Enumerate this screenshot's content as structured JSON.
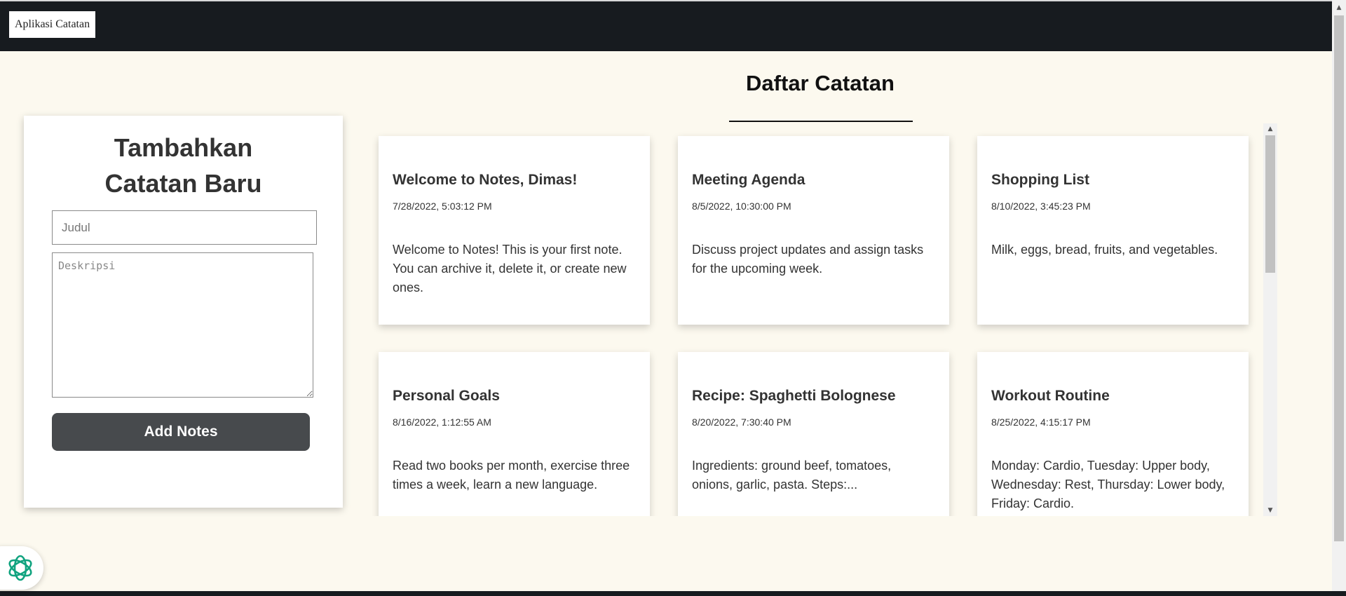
{
  "header": {
    "brand": "Aplikasi Catatan"
  },
  "add_form": {
    "title_line1": "Tambahkan",
    "title_line2": "Catatan Baru",
    "title_placeholder": "Judul",
    "title_value": "",
    "description_placeholder": "Deskripsi",
    "description_value": "",
    "submit_label": "Add Notes"
  },
  "list": {
    "heading": "Daftar Catatan",
    "notes": [
      {
        "title": "Welcome to Notes, Dimas!",
        "date": "7/28/2022, 5:03:12 PM",
        "body": "Welcome to Notes! This is your first note. You can archive it, delete it, or create new ones."
      },
      {
        "title": "Meeting Agenda",
        "date": "8/5/2022, 10:30:00 PM",
        "body": "Discuss project updates and assign tasks for the upcoming week."
      },
      {
        "title": "Shopping List",
        "date": "8/10/2022, 3:45:23 PM",
        "body": "Milk, eggs, bread, fruits, and vegetables."
      },
      {
        "title": "Personal Goals",
        "date": "8/16/2022, 1:12:55 AM",
        "body": "Read two books per month, exercise three times a week, learn a new language."
      },
      {
        "title": "Recipe: Spaghetti Bolognese",
        "date": "8/20/2022, 7:30:40 PM",
        "body": "Ingredients: ground beef, tomatoes, onions, garlic, pasta. Steps:..."
      },
      {
        "title": "Workout Routine",
        "date": "8/25/2022, 4:15:17 PM",
        "body": "Monday: Cardio, Tuesday: Upper body, Wednesday: Rest, Thursday: Lower body, Friday: Cardio."
      }
    ]
  },
  "icons": {
    "assistant": "assistant-logo-icon",
    "scroll_up": "scroll-up-arrow-icon",
    "scroll_down": "scroll-down-arrow-icon"
  },
  "colors": {
    "topbar": "#171b1f",
    "page_background": "#fcf9ef",
    "button": "#474a4d",
    "assistant_logo": "#10a37f"
  }
}
